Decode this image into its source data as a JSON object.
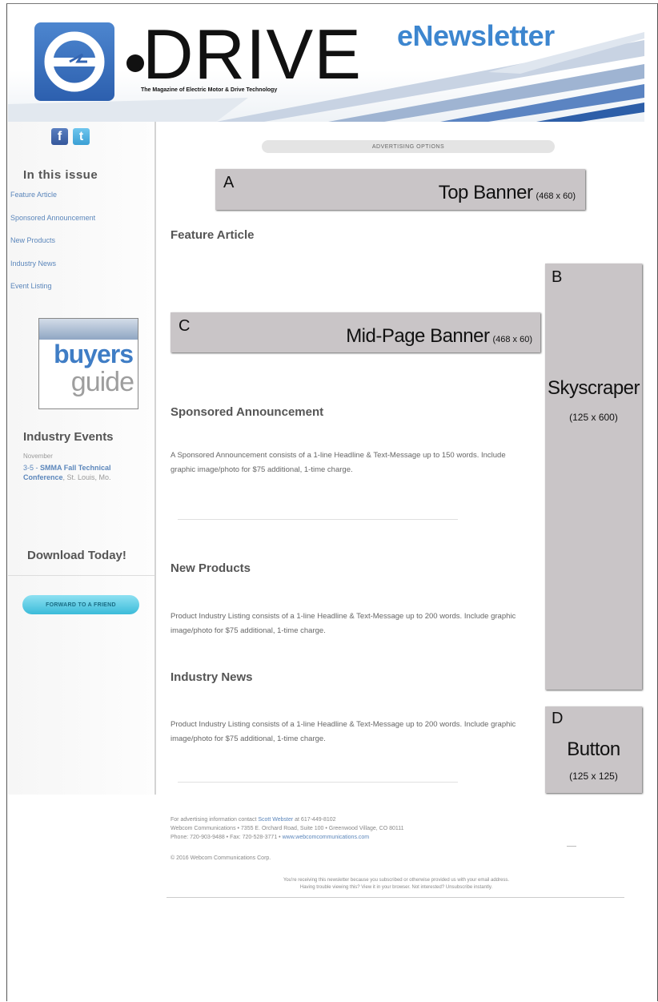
{
  "header": {
    "logo_text": "DRIVE",
    "tagline": "The Magazine of Electric Motor & Drive Technology",
    "title": "eNewsletter"
  },
  "sidebar": {
    "in_this_issue": "In this issue",
    "links": [
      "Feature Article",
      "Sponsored Announcement",
      "New Products",
      "Industry News",
      "Event Listing"
    ],
    "buyers_guide": {
      "line1": "buyers",
      "line2": "guide"
    },
    "events_title": "Industry Events",
    "event": {
      "month": "November",
      "dates": "3-5 -",
      "name": "SMMA Fall Technical Conference",
      "location": ", St. Louis, Mo."
    },
    "download": "Download Today!",
    "forward_button": "FORWARD TO A FRIEND"
  },
  "main": {
    "advertising_options": "ADVERTISING OPTIONS",
    "ads": {
      "top_banner": {
        "letter": "A",
        "label": "Top Banner",
        "size": "(468 x 60)"
      },
      "skyscraper": {
        "letter": "B",
        "label": "Skyscraper",
        "size": "(125 x 600)"
      },
      "mid_banner": {
        "letter": "C",
        "label": "Mid-Page Banner",
        "size": "(468 x 60)"
      },
      "button": {
        "letter": "D",
        "label": "Button",
        "size": "(125 x 125)"
      }
    },
    "sections": {
      "feature": {
        "heading": "Feature Article"
      },
      "sponsored": {
        "heading": "Sponsored Announcement",
        "body": "A Sponsored Announcement consists of a 1-line Headline & Text-Message up to 150 words. Include graphic image/photo for $75 additional, 1-time charge."
      },
      "products": {
        "heading": "New Products",
        "body": "Product Industry Listing consists of a 1-line Headline & Text-Message up to 200 words. Include graphic image/photo for $75 additional, 1-time charge."
      },
      "news": {
        "heading": "Industry News",
        "body": "Product Industry Listing consists of a 1-line Headline & Text-Message up to 200 words. Include graphic image/photo for $75 additional, 1-time charge."
      }
    }
  },
  "footer": {
    "line1_pre": "For advertising information contact",
    "line1_link": "Scott Webster",
    "line1_post": "at 617-449-8102",
    "line2": "Webcom Communications • 7355 E. Orchard Road, Suite 100 • Greenwood Village, CO 80111",
    "line3_pre": "Phone: 720-903-9488 • Fax: 720-528-3771 •",
    "line3_link": "www.webcomcommunications.com",
    "copyright": "© 2016 Webcom Communications Corp.",
    "notice1": "You're receiving this newsletter because you subscribed or otherwise provided us with your email address.",
    "notice2": "Having trouble viewing this? View it in your browser. Not interested? Unsubscribe instantly."
  }
}
